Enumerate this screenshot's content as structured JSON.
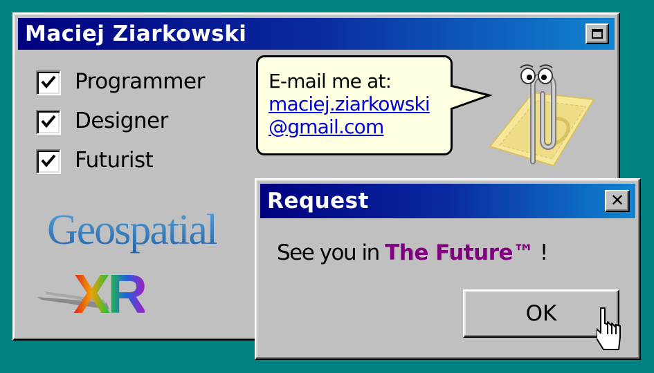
{
  "main_window": {
    "title": "Maciej Ziarkowski",
    "checkboxes": [
      {
        "label": "Programmer",
        "checked": true
      },
      {
        "label": "Designer",
        "checked": true
      },
      {
        "label": "Futurist",
        "checked": true
      }
    ],
    "logos": {
      "geospatial": "Geospatial",
      "xr": "XR"
    }
  },
  "assistant": {
    "icon": "paperclip-assistant-icon",
    "balloon": {
      "line1": "E-mail me at:",
      "link_line1": "maciej.ziarkowski",
      "link_line2": "@gmail.com"
    }
  },
  "dialog": {
    "title": "Request",
    "message_prefix": "See you in",
    "message_brand": "The Future™",
    "message_suffix": "!",
    "ok_label": "OK"
  },
  "colors": {
    "desktop": "#008080",
    "titlebar_start": "#000080",
    "titlebar_end": "#1084d0",
    "window_face": "#c0c0c0",
    "balloon": "#ffffe1",
    "link": "#0000e0",
    "brand": "#800080"
  }
}
